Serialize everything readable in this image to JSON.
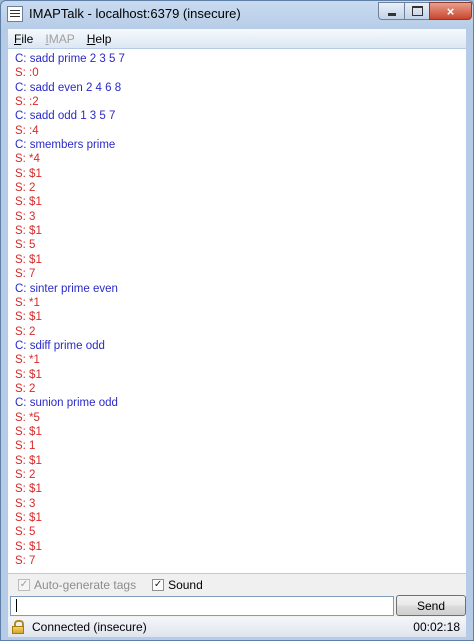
{
  "window": {
    "title": "IMAPTalk - localhost:6379 (insecure)",
    "icon": "app-window-icon",
    "controls": {
      "minimize": "minimize",
      "maximize": "maximize",
      "close": "×"
    }
  },
  "menu": [
    {
      "label": "File",
      "enabled": true
    },
    {
      "label": "IMAP",
      "enabled": false
    },
    {
      "label": "Help",
      "enabled": true
    }
  ],
  "log": [
    {
      "kind": "client",
      "text": "C: sadd prime 2 3 5 7"
    },
    {
      "kind": "server",
      "text": "S: :0"
    },
    {
      "kind": "client",
      "text": "C: sadd even 2 4 6 8"
    },
    {
      "kind": "server",
      "text": "S: :2"
    },
    {
      "kind": "client",
      "text": "C: sadd odd 1 3 5 7"
    },
    {
      "kind": "server",
      "text": "S: :4"
    },
    {
      "kind": "client",
      "text": "C: smembers prime"
    },
    {
      "kind": "server",
      "text": "S: *4"
    },
    {
      "kind": "server",
      "text": "S: $1"
    },
    {
      "kind": "server",
      "text": "S: 2"
    },
    {
      "kind": "server",
      "text": "S: $1"
    },
    {
      "kind": "server",
      "text": "S: 3"
    },
    {
      "kind": "server",
      "text": "S: $1"
    },
    {
      "kind": "server",
      "text": "S: 5"
    },
    {
      "kind": "server",
      "text": "S: $1"
    },
    {
      "kind": "server",
      "text": "S: 7"
    },
    {
      "kind": "client",
      "text": "C: sinter prime even"
    },
    {
      "kind": "server",
      "text": "S: *1"
    },
    {
      "kind": "server",
      "text": "S: $1"
    },
    {
      "kind": "server",
      "text": "S: 2"
    },
    {
      "kind": "client",
      "text": "C: sdiff prime odd"
    },
    {
      "kind": "server",
      "text": "S: *1"
    },
    {
      "kind": "server",
      "text": "S: $1"
    },
    {
      "kind": "server",
      "text": "S: 2"
    },
    {
      "kind": "client",
      "text": "C: sunion prime odd"
    },
    {
      "kind": "server",
      "text": "S: *5"
    },
    {
      "kind": "server",
      "text": "S: $1"
    },
    {
      "kind": "server",
      "text": "S: 1"
    },
    {
      "kind": "server",
      "text": "S: $1"
    },
    {
      "kind": "server",
      "text": "S: 2"
    },
    {
      "kind": "server",
      "text": "S: $1"
    },
    {
      "kind": "server",
      "text": "S: 3"
    },
    {
      "kind": "server",
      "text": "S: $1"
    },
    {
      "kind": "server",
      "text": "S: 5"
    },
    {
      "kind": "server",
      "text": "S: $1"
    },
    {
      "kind": "server",
      "text": "S: 7"
    }
  ],
  "colors": {
    "client": "#2a2ac8",
    "server": "#d52a2a"
  },
  "options": {
    "auto_tags": {
      "label": "Auto-generate tags",
      "checked": true,
      "enabled": false,
      "mark": "✓"
    },
    "sound": {
      "label": "Sound",
      "checked": true,
      "enabled": true,
      "mark": "✓"
    }
  },
  "command": {
    "value": "",
    "placeholder": ""
  },
  "send_label": "Send",
  "status": {
    "icon": "lock-icon",
    "text": "Connected (insecure)",
    "timer": "00:02:18"
  }
}
